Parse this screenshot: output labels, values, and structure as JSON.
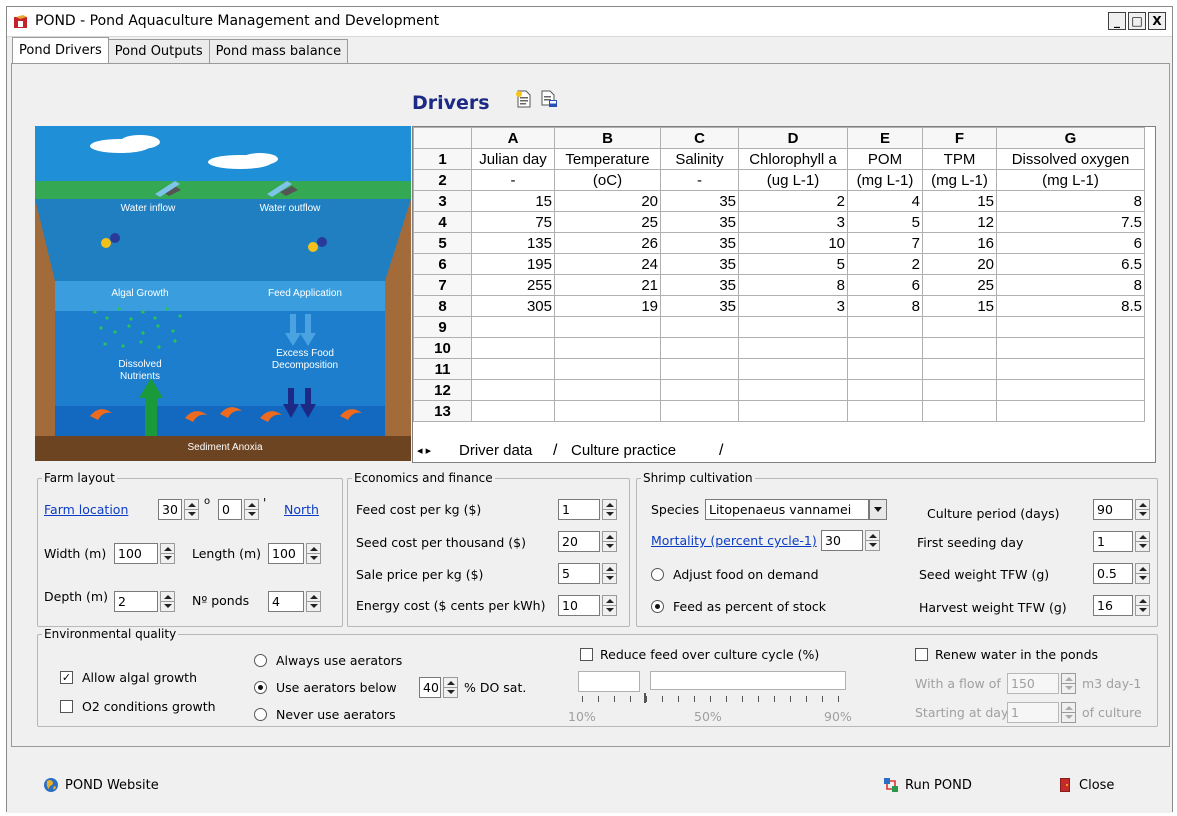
{
  "window": {
    "title": "POND - Pond Aquaculture Management and Development",
    "minimize": "_",
    "maximize": "□",
    "close": "X"
  },
  "tabs": [
    "Pond Drivers",
    "Pond Outputs",
    "Pond mass balance"
  ],
  "drivers": {
    "title": "Drivers"
  },
  "illustration": {
    "labels": {
      "water_inflow": "Water inflow",
      "water_outflow": "Water outflow",
      "algal_growth": "Algal Growth",
      "feed_application": "Feed Application",
      "dissolved_nutrients": "Dissolved Nutrients",
      "excess_food": "Excess Food Decomposition",
      "sediment_anoxia": "Sediment Anoxia"
    }
  },
  "grid": {
    "col_letters": [
      "",
      "A",
      "B",
      "C",
      "D",
      "E",
      "F",
      "G"
    ],
    "rows": [
      [
        "1",
        "Julian day",
        "Temperature",
        "Salinity",
        "Chlorophyll a",
        "POM",
        "TPM",
        "Dissolved oxygen"
      ],
      [
        "2",
        "-",
        "(oC)",
        "-",
        "(ug L-1)",
        "(mg L-1)",
        "(mg L-1)",
        "(mg L-1)"
      ],
      [
        "3",
        "15",
        "20",
        "35",
        "2",
        "4",
        "15",
        "8"
      ],
      [
        "4",
        "75",
        "25",
        "35",
        "3",
        "5",
        "12",
        "7.5"
      ],
      [
        "5",
        "135",
        "26",
        "35",
        "10",
        "7",
        "16",
        "6"
      ],
      [
        "6",
        "195",
        "24",
        "35",
        "5",
        "2",
        "20",
        "6.5"
      ],
      [
        "7",
        "255",
        "21",
        "35",
        "8",
        "6",
        "25",
        "8"
      ],
      [
        "8",
        "305",
        "19",
        "35",
        "3",
        "8",
        "15",
        "8.5"
      ],
      [
        "9",
        "",
        "",
        "",
        "",
        "",
        "",
        ""
      ],
      [
        "10",
        "",
        "",
        "",
        "",
        "",
        "",
        ""
      ],
      [
        "11",
        "",
        "",
        "",
        "",
        "",
        "",
        ""
      ],
      [
        "12",
        "",
        "",
        "",
        "",
        "",
        "",
        ""
      ],
      [
        "13",
        "",
        "",
        "",
        "",
        "",
        "",
        ""
      ]
    ],
    "sheet_tabs": [
      "Driver data",
      "Culture practice"
    ]
  },
  "farm_layout": {
    "title": "Farm layout",
    "location_label": "Farm location",
    "lat_deg": "30",
    "deg_symbol": "o",
    "lat_min": "0",
    "min_symbol": "'",
    "hemisphere": "North",
    "width_label": "Width (m)",
    "width": "100",
    "length_label": "Length (m)",
    "length": "100",
    "depth_label": "Depth (m)",
    "depth": "2",
    "ponds_label": "Nº ponds",
    "ponds": "4"
  },
  "economics": {
    "title": "Economics and finance",
    "feed_cost_label": "Feed cost per kg ($)",
    "feed_cost": "1",
    "seed_cost_label": "Seed cost per thousand ($)",
    "seed_cost": "20",
    "sale_price_label": "Sale price per kg ($)",
    "sale_price": "5",
    "energy_cost_label": "Energy cost ($ cents per kWh)",
    "energy_cost": "10"
  },
  "shrimp": {
    "title": "Shrimp cultivation",
    "species_label": "Species",
    "species": "Litopenaeus vannamei",
    "mortality_label": "Mortality (percent cycle-1)",
    "mortality": "30",
    "adjust_food_label": "Adjust food on demand",
    "feed_percent_label": "Feed as percent of stock",
    "culture_period_label": "Culture period (days)",
    "culture_period": "90",
    "first_seeding_label": "First seeding day",
    "first_seeding": "1",
    "seed_weight_label": "Seed weight TFW (g)",
    "seed_weight": "0.5",
    "harvest_weight_label": "Harvest weight TFW (g)",
    "harvest_weight": "16"
  },
  "environment": {
    "title": "Environmental quality",
    "allow_algal_label": "Allow algal growth",
    "allow_algal_checked": true,
    "o2_conditions_label": "O2 conditions growth",
    "o2_conditions_checked": false,
    "always_aerators_label": "Always use aerators",
    "use_aerators_below_label": "Use aerators below",
    "aerators_threshold": "40",
    "do_sat_label": "% DO sat.",
    "never_aerators_label": "Never use aerators",
    "reduce_feed_label": "Reduce feed over culture cycle (%)",
    "reduce_feed_checked": false,
    "slider_ticks": [
      "10%",
      "50%",
      "90%"
    ],
    "renew_water_label": "Renew water in the ponds",
    "renew_water_checked": false,
    "flow_label": "With a flow of",
    "flow": "150",
    "flow_unit": "m3 day-1",
    "starting_day_label": "Starting at day",
    "starting_day": "1",
    "of_culture_label": "of culture"
  },
  "footer": {
    "website_label": "POND Website",
    "run_label": "Run POND",
    "close_label": "Close"
  }
}
